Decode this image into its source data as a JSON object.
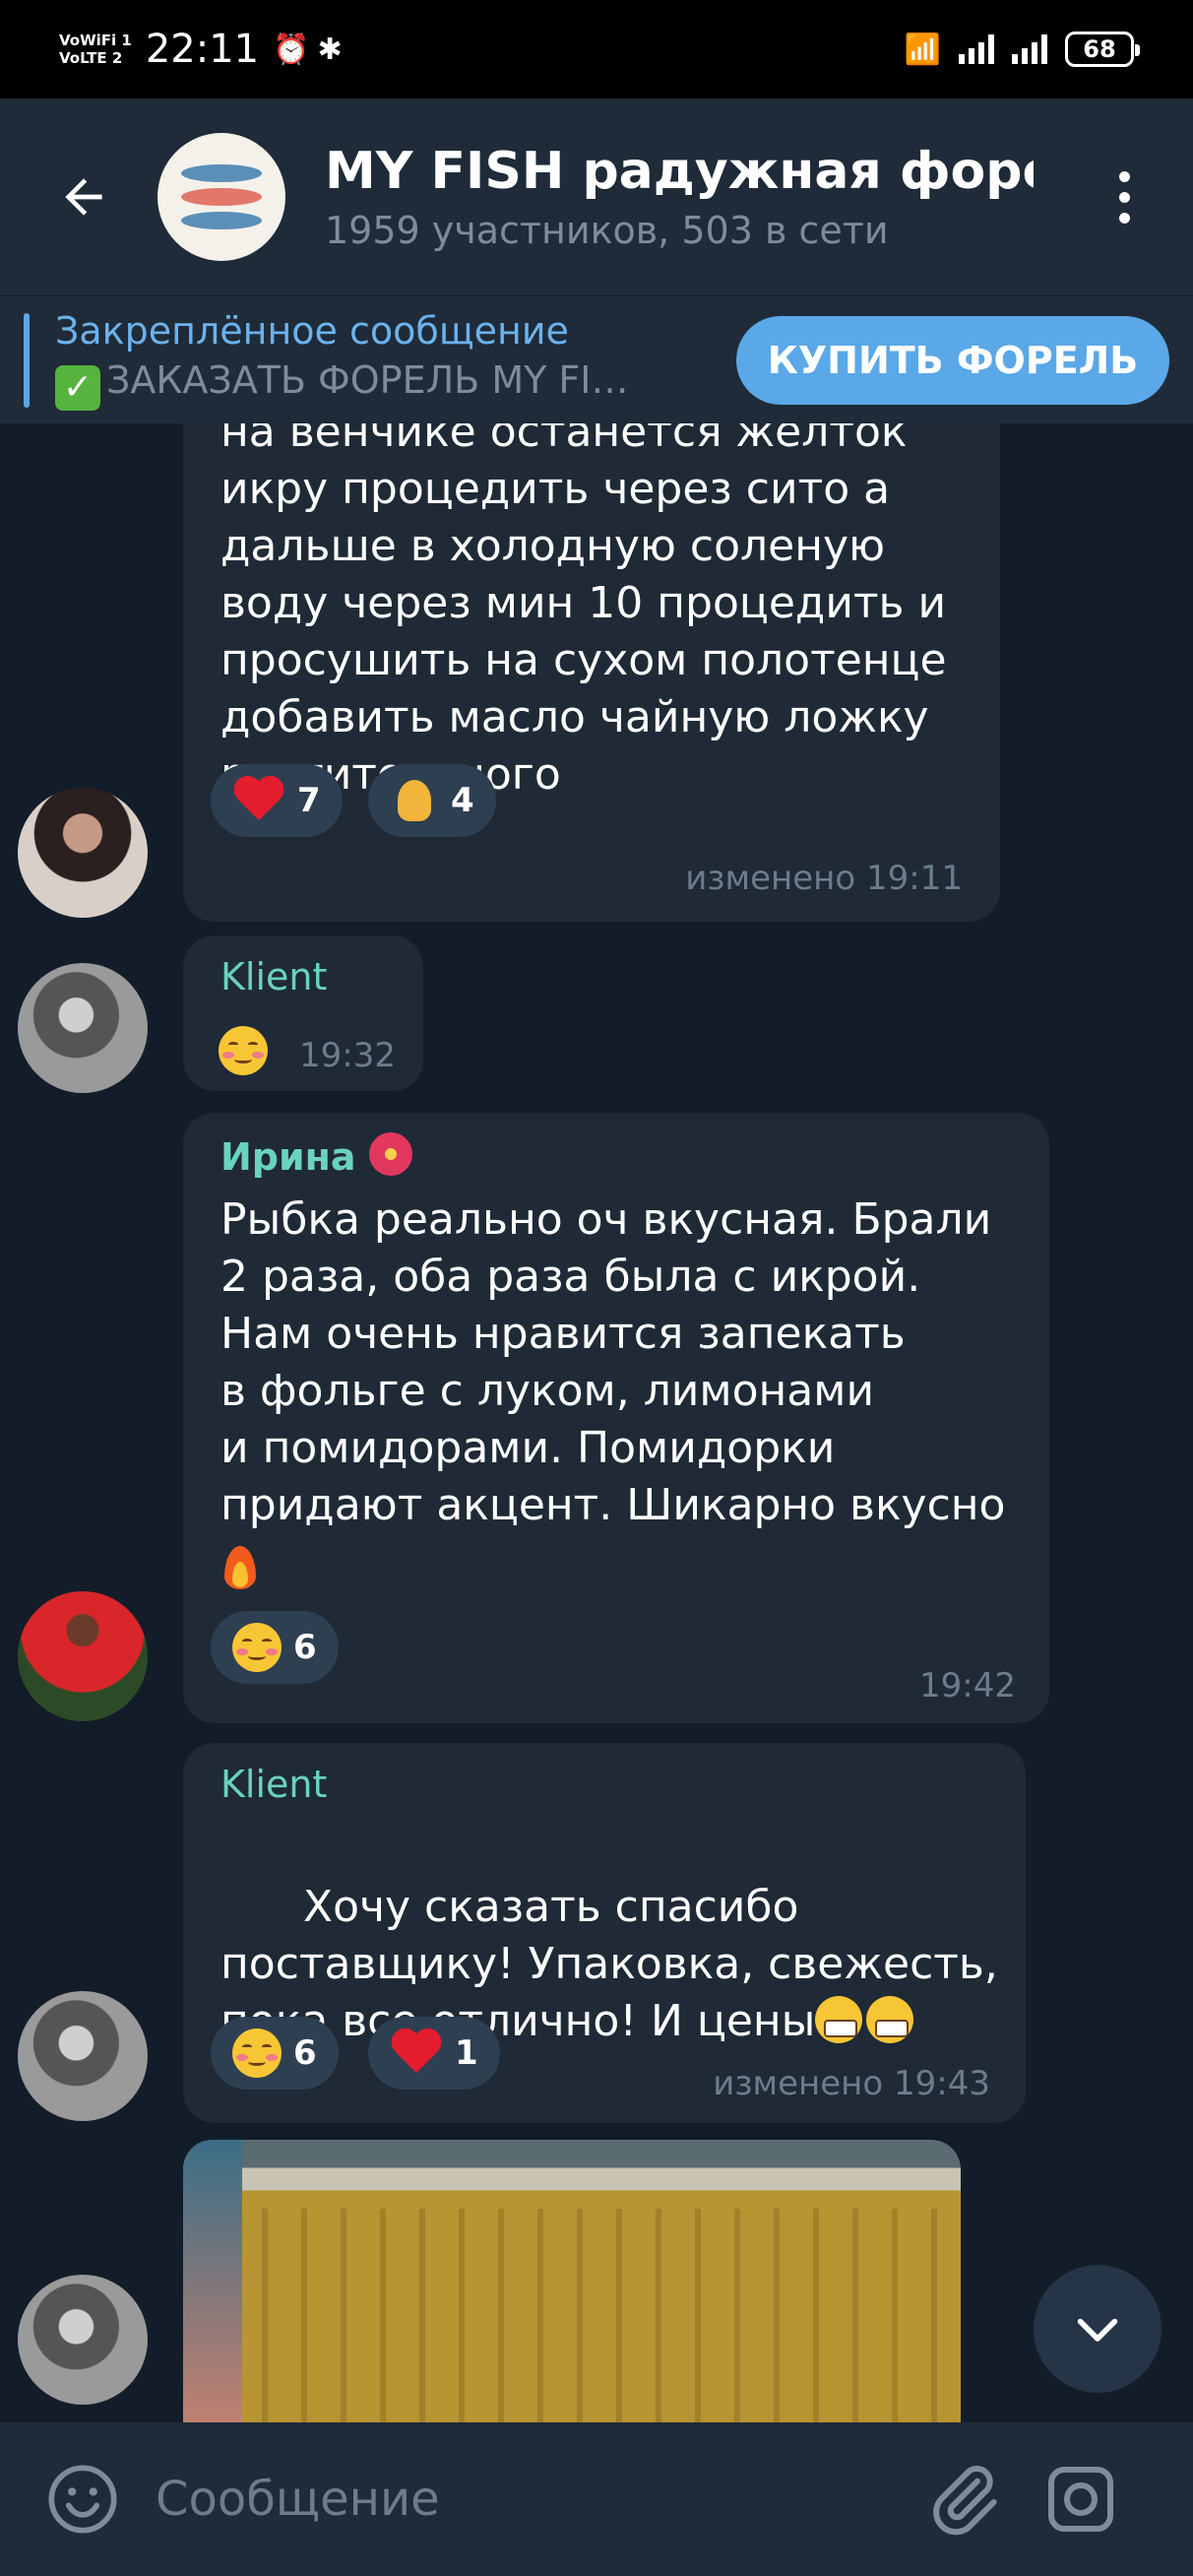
{
  "status_bar": {
    "net_tag_1": "VoWiFi 1",
    "net_tag_2": "VoLTE 2",
    "time": "22:11",
    "battery": "68"
  },
  "header": {
    "title": "MY FISH радужная форел",
    "subtitle": "1959 участников, 503 в сети"
  },
  "pinned": {
    "label": "Закреплённое сообщение",
    "text": "ЗАКАЗАТЬ ФОРЕЛЬ MY FI…",
    "button": "КУПИТЬ ФОРЕЛЬ"
  },
  "messages": [
    {
      "text": "на венчике останется жёлток\nикру процедить через сито а\nдальше в холодную соленую\nводу через мин 10 процедить и\nпросушить на сухом полотенце\nдобавить масло чайную ложку\nрастительного",
      "reactions": [
        {
          "emoji": "heart",
          "count": "7"
        },
        {
          "emoji": "folded-hands",
          "count": "4"
        }
      ],
      "time": "изменено 19:11"
    },
    {
      "sender": "Klient",
      "time": "19:32"
    },
    {
      "sender": "Ирина",
      "text": "Рыбка реально оч вкусная. Брали\n2 раза, оба раза была с икрой.\nНам очень нравится запекать\nв фольге с луком, лимонами\nи помидорами. Помидорки\nпридают акцент. Шикарно вкусно",
      "reactions": [
        {
          "emoji": "smiling-face-with-hearts",
          "count": "6"
        }
      ],
      "time": "19:42"
    },
    {
      "sender": "Klient",
      "text": "Хочу сказать спасибо\nпоставщику! Упаковка, свежесть,\nпока все отлично! И цены",
      "reactions": [
        {
          "emoji": "smiling-face-with-hearts",
          "count": "6"
        },
        {
          "emoji": "heart",
          "count": "1"
        }
      ],
      "time": "изменено 19:43"
    }
  ],
  "composer": {
    "placeholder": "Сообщение"
  },
  "colors": {
    "background": "#131d29",
    "bubble": "#1f2a36",
    "accent": "#5aa8e8",
    "sender_name": "#6ad3bd"
  }
}
